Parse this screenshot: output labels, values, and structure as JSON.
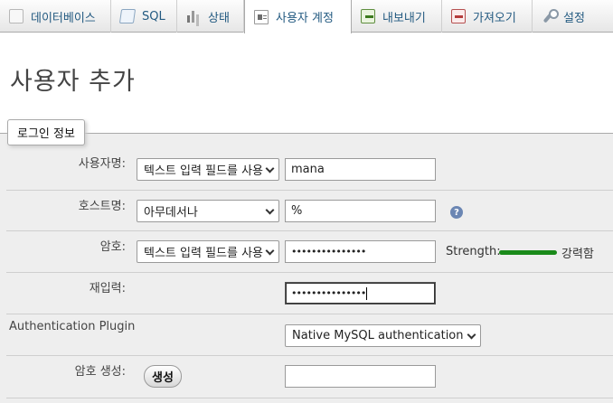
{
  "tabs": [
    {
      "label": "데이터베이스",
      "icon": "database-icon"
    },
    {
      "label": "SQL",
      "icon": "sql-icon"
    },
    {
      "label": "상태",
      "icon": "status-chart-icon"
    },
    {
      "label": "사용자 계정",
      "icon": "user-accounts-icon",
      "active": true
    },
    {
      "label": "내보내기",
      "icon": "export-icon"
    },
    {
      "label": "가져오기",
      "icon": "import-icon"
    },
    {
      "label": "설정",
      "icon": "wrench-icon"
    }
  ],
  "page": {
    "title": "사용자 추가"
  },
  "fieldset": {
    "legend": "로그인 정보"
  },
  "form": {
    "username": {
      "label": "사용자명:",
      "select_value": "텍스트 입력 필드를 사용",
      "input_value": "mana"
    },
    "hostname": {
      "label": "호스트명:",
      "select_value": "아무데서나",
      "input_value": "%",
      "help_icon": "help-icon"
    },
    "password": {
      "label": "암호:",
      "select_value": "텍스트 입력 필드를 사용",
      "input_value": "•••••••••••••••",
      "strength_label": "Strength:",
      "strength_text": "강력함",
      "strength_color": "#1a8a1a"
    },
    "reenter": {
      "label": "재입력:",
      "input_value": "•••••••••••••••"
    },
    "auth_plugin": {
      "label": "Authentication Plugin",
      "select_value": "Native MySQL authentication"
    },
    "generate": {
      "label": "암호 생성:",
      "button_label": "생성",
      "input_value": ""
    }
  },
  "colors": {
    "tab_link": "#235a81",
    "fieldset_bg": "#eeeeee"
  }
}
